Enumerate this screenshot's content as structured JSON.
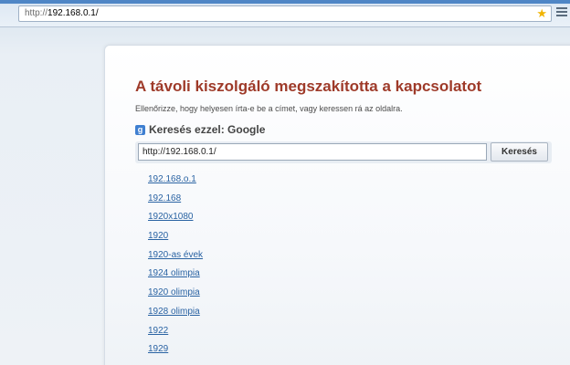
{
  "browser": {
    "address_prefix": "http://",
    "address_host": "192.168.0.1/"
  },
  "error": {
    "title": "A távoli kiszolgáló megszakította a kapcsolatot",
    "message": "Ellenőrizze, hogy helyesen írta-e be a címet, vagy keressen rá az oldalra."
  },
  "search": {
    "badge": "g",
    "heading": "Keresés ezzel: Google",
    "input_value": "http://192.168.0.1/",
    "button_label": "Keresés"
  },
  "suggestions": [
    "192.168.o.1",
    "192.168",
    "1920x1080",
    "1920",
    "1920-as évek",
    "1924 olimpia",
    "1920 olimpia",
    "1928 olimpia",
    "1922",
    "1929"
  ]
}
